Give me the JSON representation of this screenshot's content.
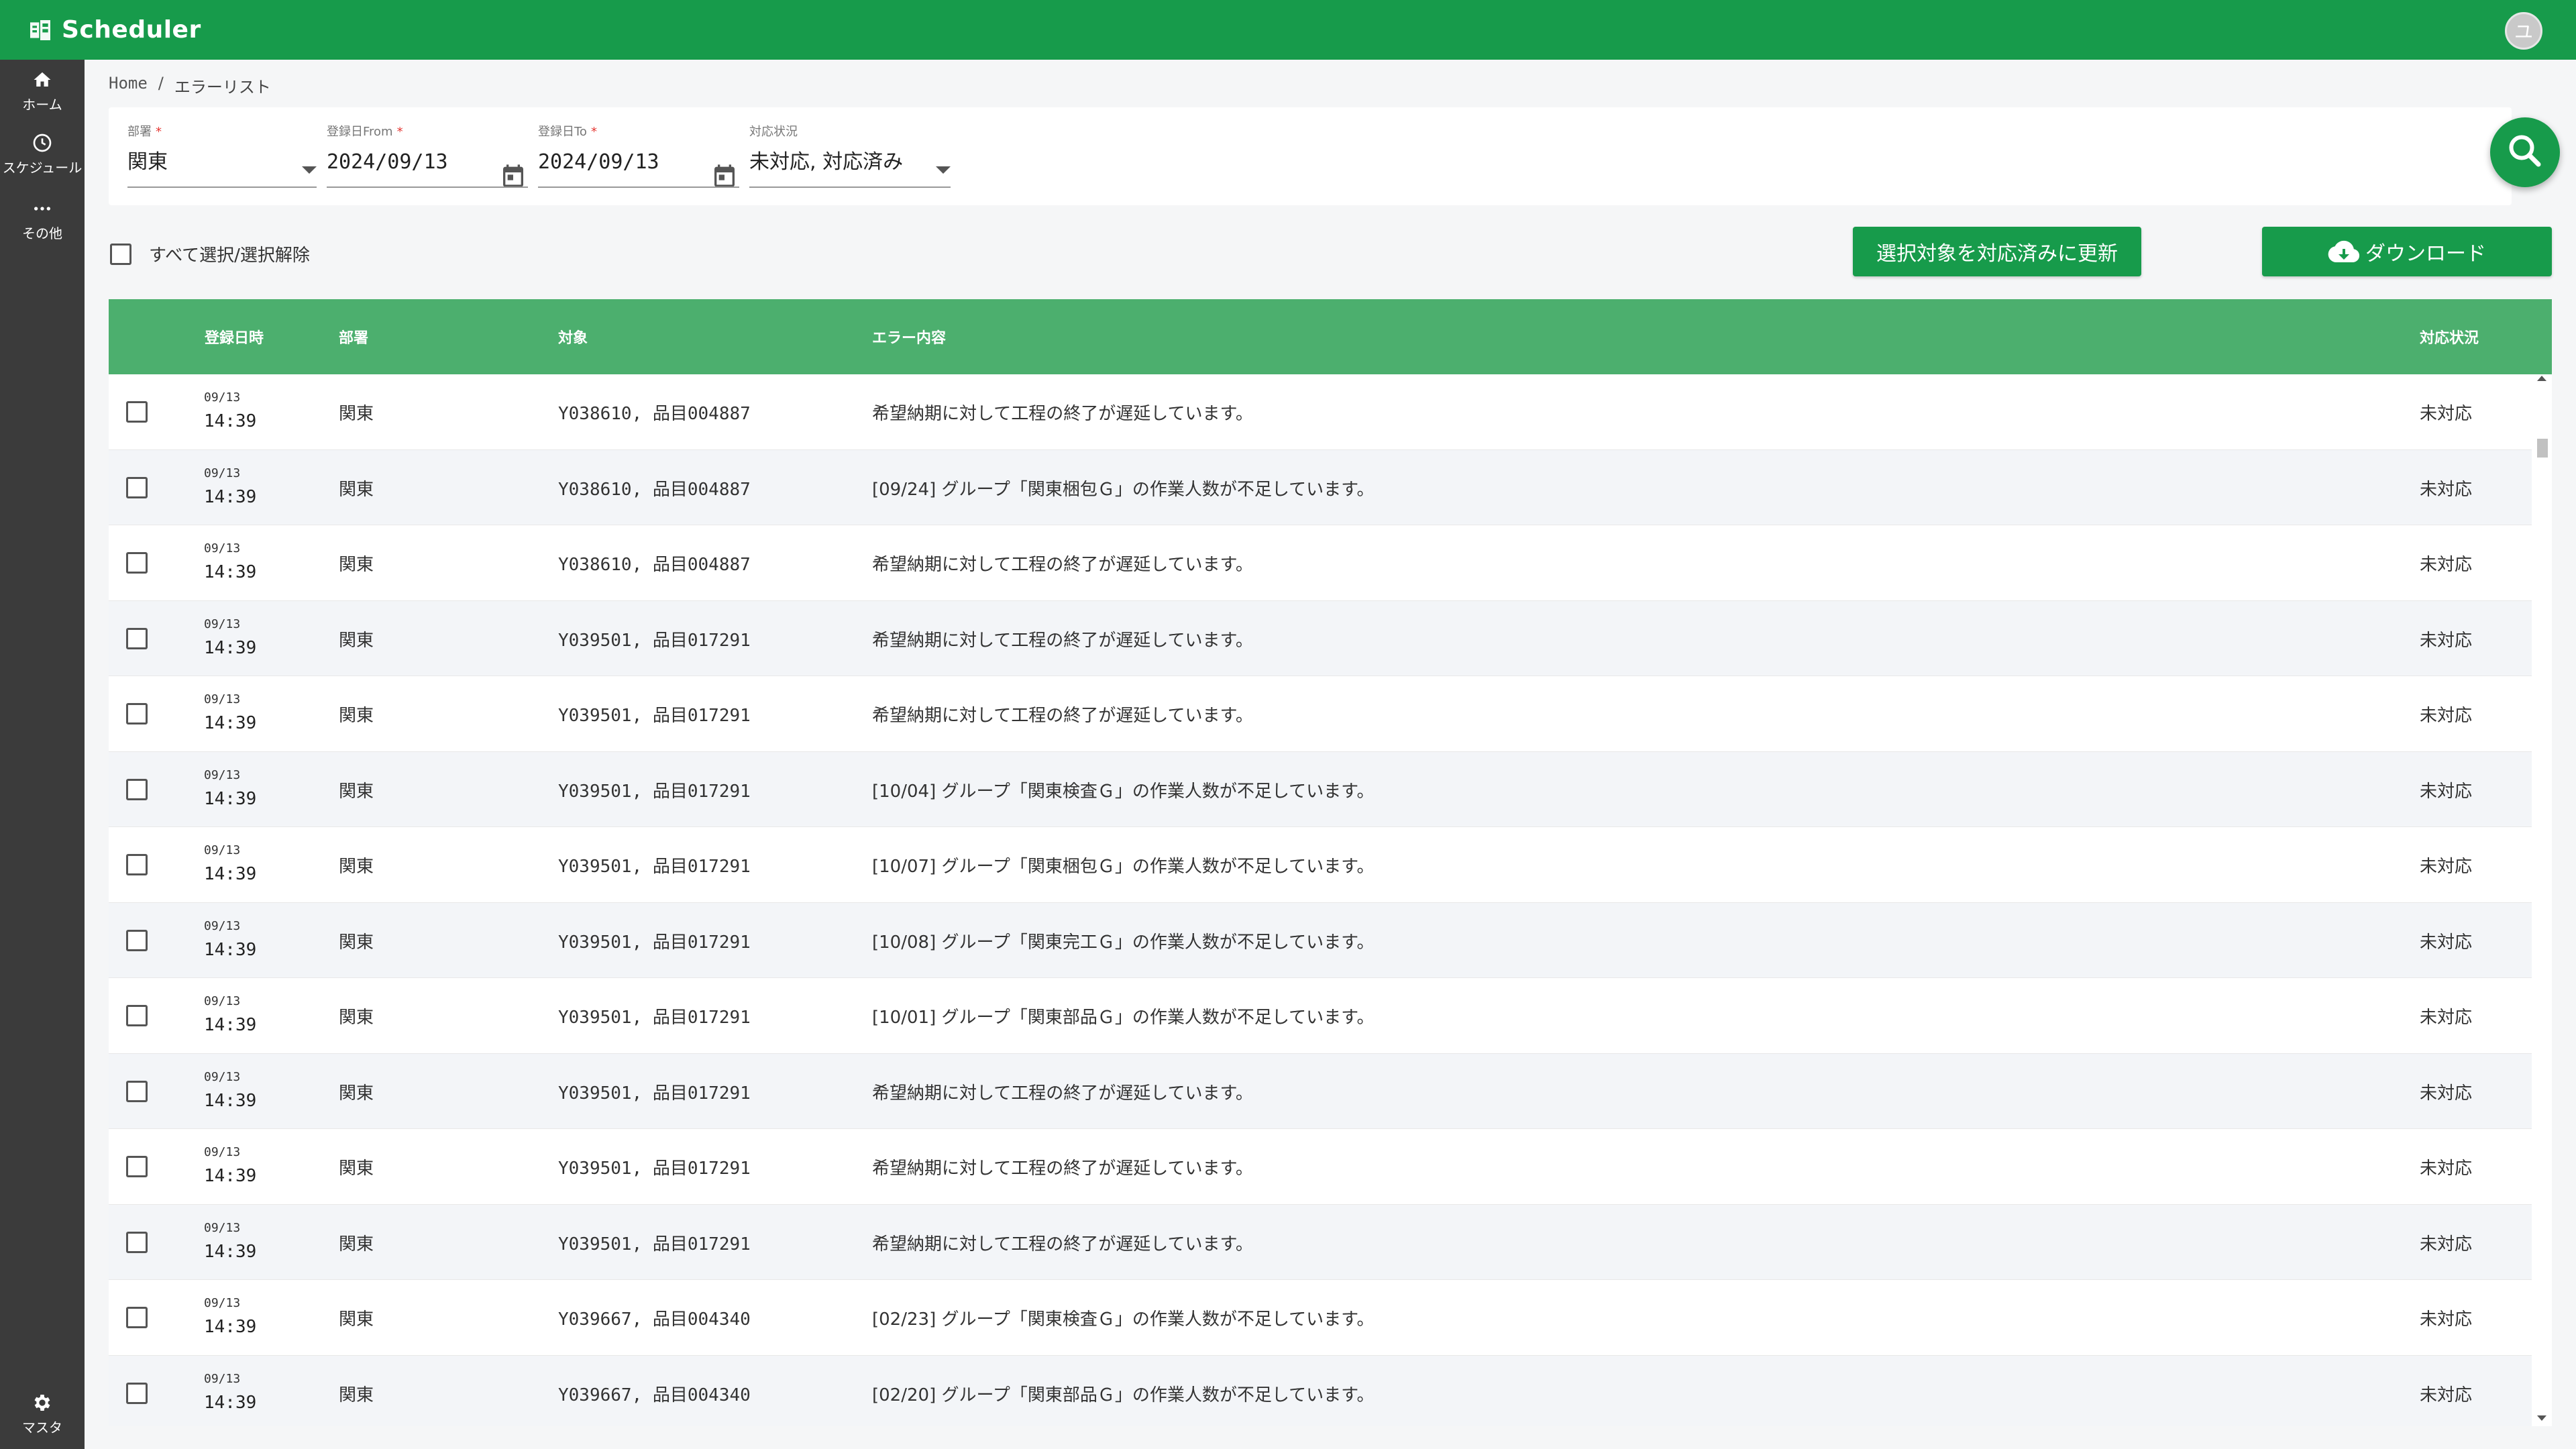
{
  "colors": {
    "brand": "#179b4b",
    "header_row": "#4caf6e",
    "sidenav": "#3b3b3b"
  },
  "app": {
    "title": "Scheduler",
    "avatar_initial": "ユ"
  },
  "nav": {
    "home": "ホーム",
    "schedule": "スケジュール",
    "other": "その他",
    "master": "マスタ"
  },
  "breadcrumb": {
    "home": "Home",
    "separator": "/",
    "current": "エラーリスト"
  },
  "filters": {
    "dept": {
      "label": "部署",
      "required": "*",
      "value": "関東"
    },
    "date_from": {
      "label": "登録日From",
      "required": "*",
      "value": "2024/09/13"
    },
    "date_to": {
      "label": "登録日To",
      "required": "*",
      "value": "2024/09/13"
    },
    "status": {
      "label": "対応状況",
      "value": "未対応, 対応済み"
    }
  },
  "actions": {
    "select_all": "すべて選択/選択解除",
    "update_selected": "選択対象を対応済みに更新",
    "download": "ダウンロード"
  },
  "table": {
    "headers": {
      "registered": "登録日時",
      "dept": "部署",
      "target": "対象",
      "error": "エラー内容",
      "status": "対応状況"
    },
    "rows": [
      {
        "date": "09/13",
        "time": "14:39",
        "dept": "関東",
        "target": "Y038610, 品目004887",
        "message": "希望納期に対して工程の終了が遅延しています。",
        "status": "未対応"
      },
      {
        "date": "09/13",
        "time": "14:39",
        "dept": "関東",
        "target": "Y038610, 品目004887",
        "message": "[09/24] グループ「関東梱包Ｇ」の作業人数が不足しています。",
        "status": "未対応"
      },
      {
        "date": "09/13",
        "time": "14:39",
        "dept": "関東",
        "target": "Y038610, 品目004887",
        "message": "希望納期に対して工程の終了が遅延しています。",
        "status": "未対応"
      },
      {
        "date": "09/13",
        "time": "14:39",
        "dept": "関東",
        "target": "Y039501, 品目017291",
        "message": "希望納期に対して工程の終了が遅延しています。",
        "status": "未対応"
      },
      {
        "date": "09/13",
        "time": "14:39",
        "dept": "関東",
        "target": "Y039501, 品目017291",
        "message": "希望納期に対して工程の終了が遅延しています。",
        "status": "未対応"
      },
      {
        "date": "09/13",
        "time": "14:39",
        "dept": "関東",
        "target": "Y039501, 品目017291",
        "message": "[10/04] グループ「関東検査Ｇ」の作業人数が不足しています。",
        "status": "未対応"
      },
      {
        "date": "09/13",
        "time": "14:39",
        "dept": "関東",
        "target": "Y039501, 品目017291",
        "message": "[10/07] グループ「関東梱包Ｇ」の作業人数が不足しています。",
        "status": "未対応"
      },
      {
        "date": "09/13",
        "time": "14:39",
        "dept": "関東",
        "target": "Y039501, 品目017291",
        "message": "[10/08] グループ「関東完工Ｇ」の作業人数が不足しています。",
        "status": "未対応"
      },
      {
        "date": "09/13",
        "time": "14:39",
        "dept": "関東",
        "target": "Y039501, 品目017291",
        "message": "[10/01] グループ「関東部品Ｇ」の作業人数が不足しています。",
        "status": "未対応"
      },
      {
        "date": "09/13",
        "time": "14:39",
        "dept": "関東",
        "target": "Y039501, 品目017291",
        "message": "希望納期に対して工程の終了が遅延しています。",
        "status": "未対応"
      },
      {
        "date": "09/13",
        "time": "14:39",
        "dept": "関東",
        "target": "Y039501, 品目017291",
        "message": "希望納期に対して工程の終了が遅延しています。",
        "status": "未対応"
      },
      {
        "date": "09/13",
        "time": "14:39",
        "dept": "関東",
        "target": "Y039501, 品目017291",
        "message": "希望納期に対して工程の終了が遅延しています。",
        "status": "未対応"
      },
      {
        "date": "09/13",
        "time": "14:39",
        "dept": "関東",
        "target": "Y039667, 品目004340",
        "message": "[02/23] グループ「関東検査Ｇ」の作業人数が不足しています。",
        "status": "未対応"
      },
      {
        "date": "09/13",
        "time": "14:39",
        "dept": "関東",
        "target": "Y039667, 品目004340",
        "message": "[02/20] グループ「関東部品Ｇ」の作業人数が不足しています。",
        "status": "未対応"
      }
    ]
  }
}
